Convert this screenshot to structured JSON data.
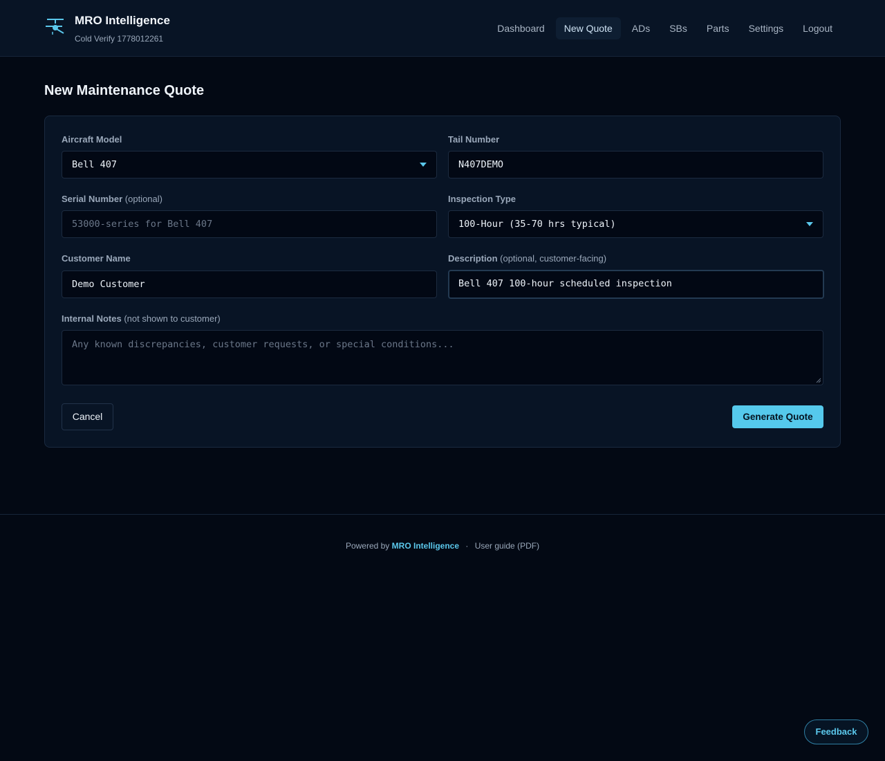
{
  "header": {
    "brand_title": "MRO Intelligence",
    "brand_subtitle": "Cold Verify 1778012261",
    "logo_icon": "helicopter-icon",
    "nav": [
      {
        "label": "Dashboard",
        "active": false
      },
      {
        "label": "New Quote",
        "active": true
      },
      {
        "label": "ADs",
        "active": false
      },
      {
        "label": "SBs",
        "active": false
      },
      {
        "label": "Parts",
        "active": false
      },
      {
        "label": "Settings",
        "active": false
      },
      {
        "label": "Logout",
        "active": false
      }
    ]
  },
  "page": {
    "title": "New Maintenance Quote"
  },
  "form": {
    "aircraft_model": {
      "label": "Aircraft Model",
      "value": "Bell 407"
    },
    "tail_number": {
      "label": "Tail Number",
      "value": "N407DEMO"
    },
    "serial_number": {
      "label": "Serial Number",
      "label_note": "(optional)",
      "placeholder": "53000-series for Bell 407",
      "value": ""
    },
    "inspection_type": {
      "label": "Inspection Type",
      "value": "100-Hour (35-70 hrs typical)"
    },
    "customer_name": {
      "label": "Customer Name",
      "value": "Demo Customer"
    },
    "description": {
      "label": "Description",
      "label_note": "(optional, customer-facing)",
      "value": "Bell 407 100-hour scheduled inspection"
    },
    "internal_notes": {
      "label": "Internal Notes",
      "label_note": "(not shown to customer)",
      "placeholder": "Any known discrepancies, customer requests, or special conditions...",
      "value": ""
    },
    "cancel_label": "Cancel",
    "generate_label": "Generate Quote"
  },
  "footer": {
    "powered_by": "Powered by",
    "brand_link": "MRO Intelligence",
    "separator": "·",
    "guide_link": "User guide (PDF)"
  },
  "feedback_label": "Feedback",
  "colors": {
    "accent": "#55c9ec",
    "background": "#030914",
    "surface": "#081425"
  }
}
